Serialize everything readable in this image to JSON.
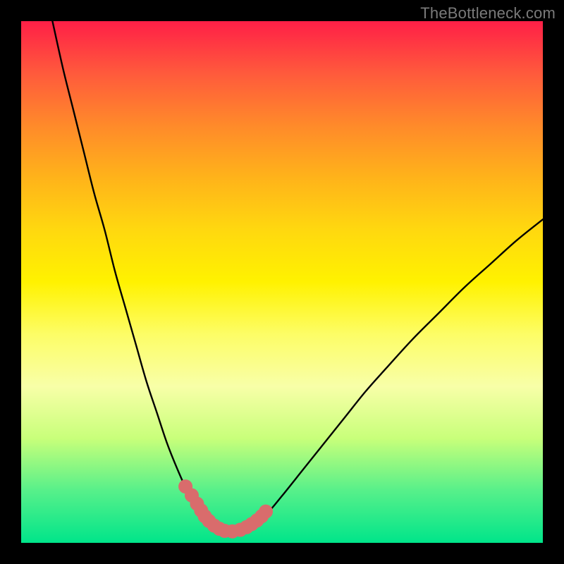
{
  "watermark": "TheBottleneck.com",
  "colors": {
    "frame": "#000000",
    "watermark": "#7a7a7a",
    "curve": "#000000",
    "marker_fill": "#d96c6c",
    "marker_stroke": "#d96c6c",
    "gradient_stops": [
      "#ff1f47",
      "#ff5a3c",
      "#ff8a2a",
      "#ffb31a",
      "#ffd80f",
      "#fff200",
      "#fdfd66",
      "#f8ffa8",
      "#c8ff7a",
      "#57f08a",
      "#00e58a"
    ]
  },
  "chart_data": {
    "type": "line",
    "title": "",
    "xlabel": "",
    "ylabel": "",
    "xlim": [
      0,
      100
    ],
    "ylim": [
      0,
      100
    ],
    "series": [
      {
        "name": "bottleneck-curve",
        "x": [
          6,
          8,
          10,
          12,
          14,
          16,
          18,
          20,
          22,
          24,
          26,
          28,
          30,
          32,
          33,
          34,
          35,
          36,
          37,
          38,
          39,
          40.5,
          42,
          44,
          47,
          50,
          54,
          58,
          62,
          66,
          70,
          75,
          80,
          85,
          90,
          95,
          100
        ],
        "y": [
          100,
          91,
          83,
          75,
          67,
          60,
          52,
          45,
          38,
          31,
          25,
          19,
          14,
          9.5,
          7.5,
          6,
          4.7,
          3.7,
          3,
          2.5,
          2.2,
          2.2,
          2.5,
          3.2,
          5.5,
          9,
          14,
          19,
          24,
          29,
          33.5,
          39,
          44,
          49,
          53.5,
          58,
          62
        ]
      }
    ],
    "markers": {
      "name": "highlight-dots",
      "x": [
        31.5,
        32.7,
        33.7,
        34.5,
        35.2,
        36.0,
        37.0,
        38.0,
        39.0,
        40.5,
        42.0,
        43.2,
        44.2,
        45.2,
        46.1,
        46.9
      ],
      "y": [
        10.8,
        9.1,
        7.5,
        6.2,
        5.1,
        4.2,
        3.3,
        2.7,
        2.3,
        2.2,
        2.5,
        3.0,
        3.6,
        4.3,
        5.1,
        6.0
      ]
    }
  }
}
